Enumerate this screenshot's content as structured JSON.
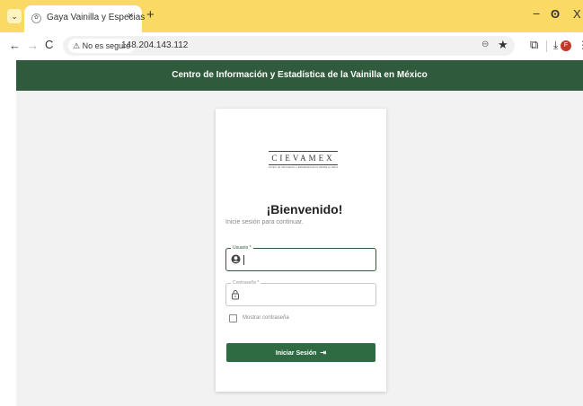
{
  "browser": {
    "tab": {
      "title": "Gaya Vainilla y Especias",
      "close": "×"
    },
    "new_tab": "+",
    "window": {
      "minimize": "−",
      "maximize": "ʘ",
      "close": "X"
    },
    "nav": {
      "back": "←",
      "forward": "→",
      "reload": "C"
    },
    "security_chip": "⚠ No es seguro",
    "url": "148.204.143.112",
    "avatar_letter": "F"
  },
  "header": {
    "title": "Centro de Información y Estadística de la Vainilla en México"
  },
  "login": {
    "logo_text": "CIEVAMEX",
    "logo_subtitle": "Centro de Información y Estadística de la Vainilla en México",
    "welcome": "¡Bienvenido!",
    "subtitle": "Inicie sesión para continuar.",
    "username_label": "Usuario *",
    "username_value": "",
    "password_label": "Contraseña *",
    "password_value": "",
    "show_password_label": "Mostrar contraseña",
    "submit_label": "Iniciar Sesión",
    "submit_icon": "⇥"
  },
  "colors": {
    "brand": "#2f5a3c",
    "button": "#2f6b42",
    "tabstrip": "#fbd965"
  },
  "icons": [
    "chevron-down-icon",
    "vanilla-favicon-icon",
    "close-icon",
    "plus-icon",
    "minimize-icon",
    "maximize-icon",
    "back-arrow-icon",
    "forward-arrow-icon",
    "reload-icon",
    "warning-icon",
    "zoom-icon",
    "star-icon",
    "extensions-icon",
    "download-icon",
    "kebab-menu-icon",
    "user-icon",
    "lock-icon",
    "login-icon"
  ]
}
